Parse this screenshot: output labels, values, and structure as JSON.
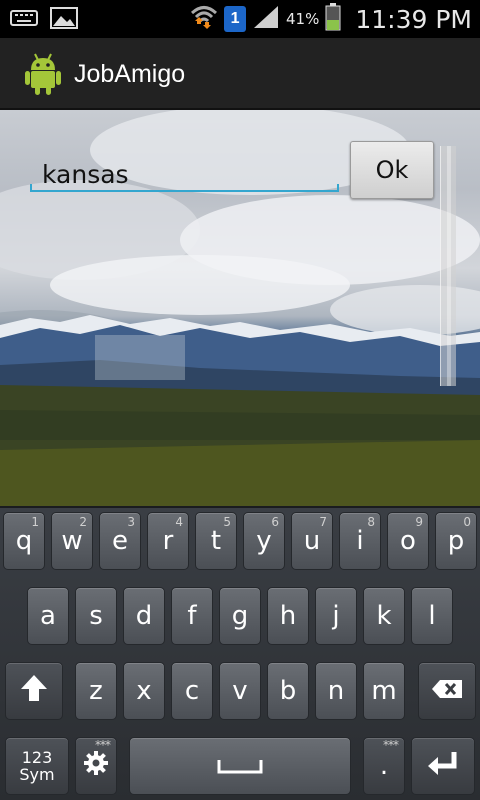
{
  "status_bar": {
    "notification_badge": "1",
    "battery_percent": "41%",
    "time": "11:39 PM",
    "icons": [
      "keyboard-icon",
      "image-icon",
      "wifi-icon",
      "signal-icon",
      "battery-icon"
    ],
    "battery_level": 0.41
  },
  "action_bar": {
    "title": "JobAmigo",
    "app_icon": "android-icon"
  },
  "search": {
    "value": "kansas",
    "ok_label": "Ok"
  },
  "keyboard": {
    "row1": [
      {
        "label": "q",
        "hint": "1"
      },
      {
        "label": "w",
        "hint": "2"
      },
      {
        "label": "e",
        "hint": "3"
      },
      {
        "label": "r",
        "hint": "4"
      },
      {
        "label": "t",
        "hint": "5"
      },
      {
        "label": "y",
        "hint": "6"
      },
      {
        "label": "u",
        "hint": "7"
      },
      {
        "label": "i",
        "hint": "8"
      },
      {
        "label": "o",
        "hint": "9"
      },
      {
        "label": "p",
        "hint": "0"
      }
    ],
    "row2": [
      "a",
      "s",
      "d",
      "f",
      "g",
      "h",
      "j",
      "k",
      "l"
    ],
    "row3": [
      "z",
      "x",
      "c",
      "v",
      "b",
      "n",
      "m"
    ],
    "sym_line1": "123",
    "sym_line2": "Sym",
    "period": ".",
    "more_dots": "***"
  },
  "colors": {
    "accent": "#33a6cf",
    "action_bar": "#222222",
    "battery_fill": "#8bc34a"
  }
}
